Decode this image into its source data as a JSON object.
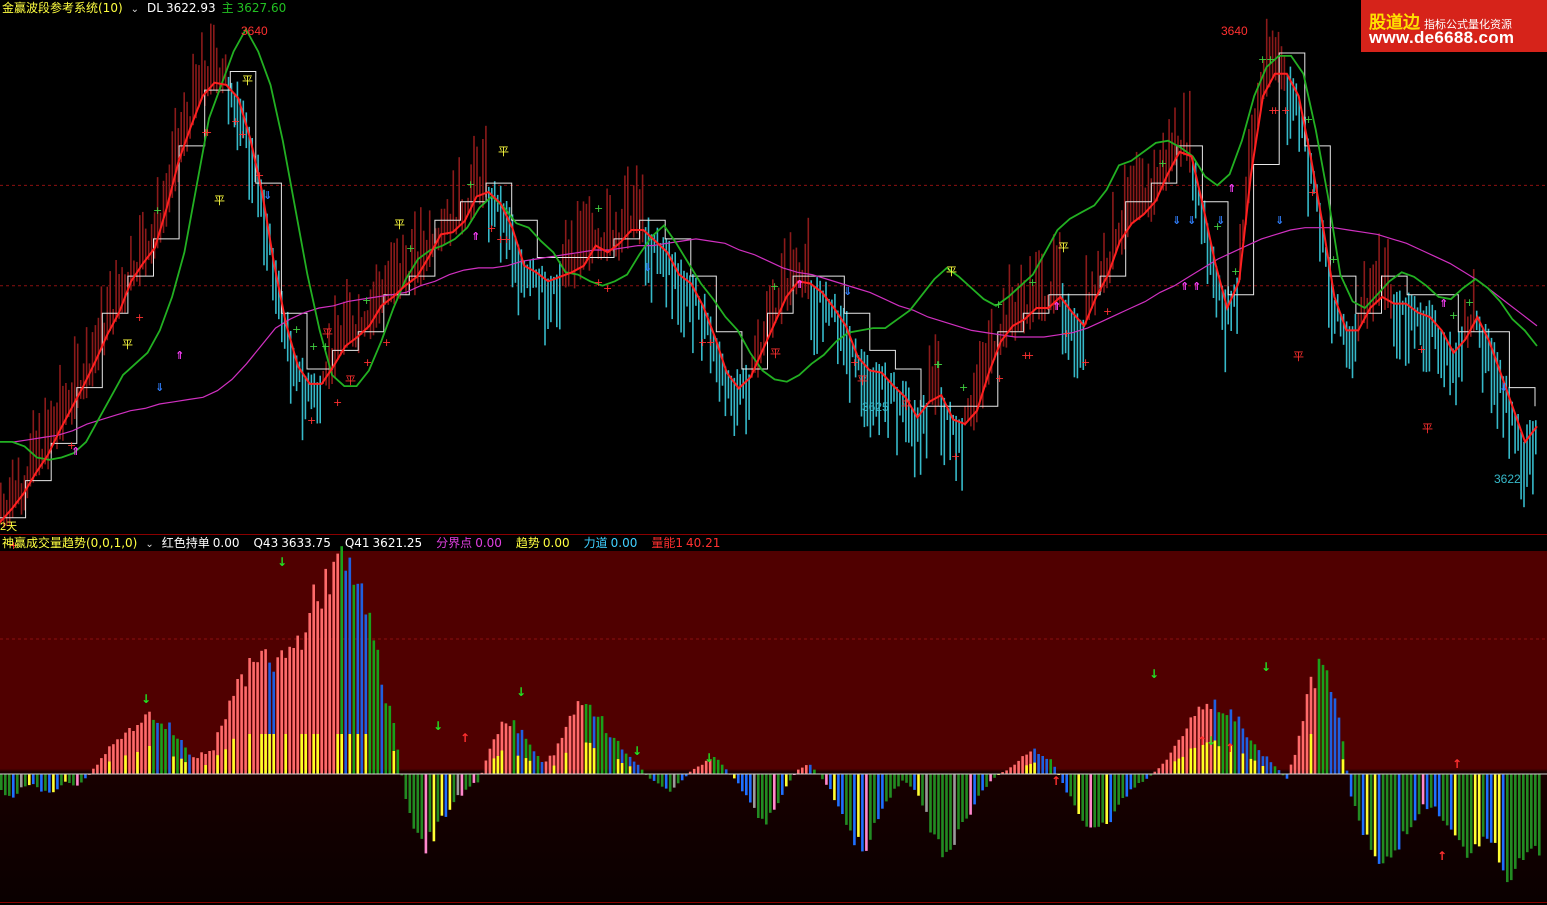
{
  "colors": {
    "background": "#000000",
    "up_bar": "#8b1a1a",
    "down_bar": "#36b9c9",
    "fast_line": "#ff2020",
    "slow_line": "#22b022",
    "ma_line": "#d030c0",
    "steps": "#e8e8e8",
    "lower_bg_top": "#500000",
    "lower_bg_bottom": "#180000",
    "vol_red": "#ff6a6a",
    "vol_yellow": "#ffff22",
    "vol_green": "#1aa01a",
    "vol_blue": "#1f5fe0",
    "vol_gray": "#9a9a9a",
    "vol_pink": "#ff66cc",
    "neg_green": "#228b22",
    "neg_blue": "#1e6fff",
    "neg_yellow": "#ffff33",
    "neg_pink": "#ff88cc"
  },
  "top_header": {
    "name": "金赢波段参考系统(10)",
    "dl_label": "DL",
    "dl_value": "3622.93",
    "main_label": "主",
    "main_value": "3627.60"
  },
  "bottom_header": {
    "name": "神赢成交量趋势(0,0,1,0)",
    "items": [
      {
        "label": "红色持单",
        "value": "0.00",
        "color": "#ffffff"
      },
      {
        "label": "Q43",
        "value": "3633.75",
        "color": "#ffffff"
      },
      {
        "label": "Q41",
        "value": "3621.25",
        "color": "#ffffff"
      },
      {
        "label": "分界点",
        "value": "0.00",
        "color": "#e040e0"
      },
      {
        "label": "趋势",
        "value": "0.00",
        "color": "#ffff40"
      },
      {
        "label": "力道",
        "value": "0.00",
        "color": "#40d0ff"
      },
      {
        "label": "量能1",
        "value": "40.21",
        "color": "#ff3030"
      }
    ]
  },
  "logo": {
    "brand": "股道边",
    "tagline": "指标公式量化资源",
    "url": "www.de6688.com"
  },
  "chart_data": [
    {
      "type": "line",
      "panel": "price",
      "y_range": [
        3620.5,
        3643
      ],
      "ref_lines": [
        3635.5,
        3631
      ],
      "fast_line": [
        3620.4,
        3621.0,
        3621.7,
        3622.6,
        3623.4,
        3624.5,
        3625.5,
        3626.5,
        3627.6,
        3628.8,
        3629.8,
        3631.2,
        3632.0,
        3632.7,
        3634.5,
        3636.6,
        3638.1,
        3639.5,
        3640.1,
        3640.0,
        3639.4,
        3637.6,
        3635.2,
        3632.0,
        3629.3,
        3627.4,
        3626.6,
        3626.6,
        3627.4,
        3628.3,
        3628.7,
        3629.2,
        3630.1,
        3630.5,
        3631.0,
        3631.4,
        3632.3,
        3633.3,
        3633.4,
        3633.9,
        3635.0,
        3635.2,
        3634.7,
        3633.6,
        3631.9,
        3631.6,
        3631.2,
        3631.4,
        3631.6,
        3631.9,
        3632.8,
        3632.5,
        3632.9,
        3633.5,
        3633.5,
        3633.0,
        3632.5,
        3631.5,
        3631.1,
        3630.1,
        3628.7,
        3627.1,
        3626.4,
        3626.9,
        3628.1,
        3629.3,
        3630.5,
        3631.2,
        3631.1,
        3630.7,
        3630.0,
        3629.2,
        3627.8,
        3627.2,
        3627.1,
        3626.5,
        3626.0,
        3625.1,
        3625.8,
        3626.1,
        3625.0,
        3624.8,
        3625.4,
        3627.1,
        3628.5,
        3629.2,
        3629.5,
        3630.0,
        3630.0,
        3630.5,
        3629.8,
        3629.2,
        3630.5,
        3631.5,
        3633.0,
        3633.8,
        3634.2,
        3634.8,
        3636.0,
        3637.0,
        3636.8,
        3634.5,
        3632.0,
        3630.0,
        3631.2,
        3636.0,
        3639.5,
        3640.5,
        3640.5,
        3639.5,
        3636.8,
        3633.8,
        3630.5,
        3629.0,
        3629.0,
        3630.0,
        3630.5,
        3630.2,
        3630.2,
        3629.8,
        3629.6,
        3629.0,
        3628.0,
        3628.6,
        3629.6,
        3628.5,
        3627.0,
        3625.5,
        3624.0,
        3624.7
      ],
      "slow_line": [
        3624.0,
        3624.0,
        3623.8,
        3623.3,
        3623.2,
        3623.3,
        3623.5,
        3624.0,
        3625.0,
        3626.0,
        3627.0,
        3627.5,
        3628.0,
        3629.0,
        3630.5,
        3632.5,
        3635.5,
        3638.5,
        3640.0,
        3641.5,
        3642.5,
        3641.5,
        3640.0,
        3637.5,
        3634.5,
        3631.5,
        3629.0,
        3627.0,
        3626.5,
        3626.5,
        3627.2,
        3628.5,
        3630.0,
        3631.3,
        3632.2,
        3632.6,
        3632.8,
        3633.1,
        3633.6,
        3634.5,
        3635.0,
        3634.5,
        3633.8,
        3633.6,
        3633.0,
        3632.5,
        3631.6,
        3631.5,
        3631.2,
        3631.0,
        3631.2,
        3631.5,
        3632.4,
        3633.2,
        3633.7,
        3632.9,
        3632.0,
        3631.1,
        3630.4,
        3629.6,
        3629.0,
        3628.0,
        3627.2,
        3626.8,
        3626.7,
        3627.0,
        3627.5,
        3627.9,
        3628.5,
        3628.9,
        3629.0,
        3629.1,
        3629.1,
        3629.5,
        3629.9,
        3630.6,
        3631.3,
        3631.8,
        3631.4,
        3630.9,
        3630.4,
        3630.1,
        3630.5,
        3631.0,
        3631.5,
        3632.5,
        3633.5,
        3634.0,
        3634.3,
        3634.6,
        3635.3,
        3636.4,
        3636.6,
        3637.0,
        3637.4,
        3637.5,
        3637.2,
        3636.8,
        3635.9,
        3635.5,
        3636.0,
        3637.5,
        3639.5,
        3640.8,
        3641.3,
        3641.3,
        3640.5,
        3638.0,
        3635.0,
        3631.5,
        3630.3,
        3630.0,
        3630.6,
        3631.2,
        3631.6,
        3631.4,
        3631.0,
        3630.5,
        3630.4,
        3630.9,
        3631.3,
        3630.9,
        3630.3,
        3629.5,
        3629.0,
        3628.3
      ],
      "ma_line": [
        3624.0,
        3624.0,
        3624.1,
        3624.2,
        3624.3,
        3624.5,
        3624.8,
        3625.0,
        3625.2,
        3625.4,
        3625.5,
        3625.7,
        3625.8,
        3625.9,
        3626.0,
        3626.3,
        3626.8,
        3627.5,
        3628.3,
        3629.1,
        3629.5,
        3629.8,
        3630.0,
        3630.1,
        3630.3,
        3630.4,
        3630.5,
        3630.6,
        3630.7,
        3631.0,
        3631.2,
        3631.5,
        3631.7,
        3631.8,
        3631.8,
        3631.9,
        3632.1,
        3632.2,
        3632.3,
        3632.4,
        3632.5,
        3632.6,
        3632.6,
        3632.7,
        3632.8,
        3632.8,
        3632.9,
        3633.0,
        3633.1,
        3633.0,
        3632.9,
        3632.6,
        3632.4,
        3632.1,
        3631.8,
        3631.6,
        3631.5,
        3631.3,
        3631.1,
        3630.9,
        3630.7,
        3630.4,
        3630.1,
        3629.9,
        3629.6,
        3629.4,
        3629.2,
        3629.0,
        3628.9,
        3628.8,
        3628.7,
        3628.7,
        3628.7,
        3628.8,
        3628.9,
        3629.1,
        3629.4,
        3629.7,
        3630.0,
        3630.3,
        3630.7,
        3631.0,
        3631.4,
        3631.8,
        3632.2,
        3632.5,
        3632.8,
        3633.1,
        3633.3,
        3633.5,
        3633.6,
        3633.6,
        3633.6,
        3633.5,
        3633.4,
        3633.3,
        3633.1,
        3632.9,
        3632.6,
        3632.3,
        3632.0,
        3631.6,
        3631.2,
        3630.7,
        3630.2,
        3629.7,
        3629.2
      ]
    },
    {
      "type": "bar",
      "panel": "volume",
      "y_range": [
        -60,
        110
      ],
      "values": [
        -8,
        -12,
        -6,
        -5,
        -9,
        -10,
        -4,
        -6,
        -2,
        5,
        12,
        18,
        22,
        28,
        30,
        26,
        23,
        18,
        8,
        10,
        13,
        30,
        42,
        50,
        55,
        60,
        58,
        60,
        66,
        80,
        92,
        100,
        105,
        96,
        88,
        70,
        45,
        22,
        -10,
        -28,
        -36,
        -28,
        -18,
        -12,
        -6,
        -4,
        14,
        23,
        27,
        20,
        12,
        6,
        10,
        20,
        32,
        36,
        30,
        23,
        16,
        9,
        4,
        -2,
        -6,
        -8,
        -4,
        2,
        5,
        9,
        4,
        -2,
        -10,
        -18,
        -25,
        -15,
        -5,
        2,
        5,
        0,
        -8,
        -18,
        -30,
        -38,
        -30,
        -18,
        -8,
        -3,
        -8,
        -20,
        -34,
        -40,
        -30,
        -22,
        -12,
        -4,
        0,
        3,
        8,
        12,
        10,
        6,
        -5,
        -16,
        -25,
        -30,
        -26,
        -18,
        -10,
        -5,
        -2,
        3,
        10,
        18,
        26,
        32,
        35,
        34,
        30,
        22,
        14,
        9,
        4,
        -3,
        14,
        42,
        52,
        46,
        30,
        -10,
        -26,
        -40,
        -46,
        -42,
        -30,
        -22,
        -16,
        -18,
        -24,
        -35,
        -42,
        -38,
        -30,
        -42,
        -52,
        -48,
        -40,
        -36
      ]
    }
  ],
  "labels": {
    "price_high_1": "3640",
    "price_high_2": "3640",
    "price_low_1": "3625",
    "price_low_2": "3622",
    "left_cut": "2天",
    "ping": "平"
  }
}
